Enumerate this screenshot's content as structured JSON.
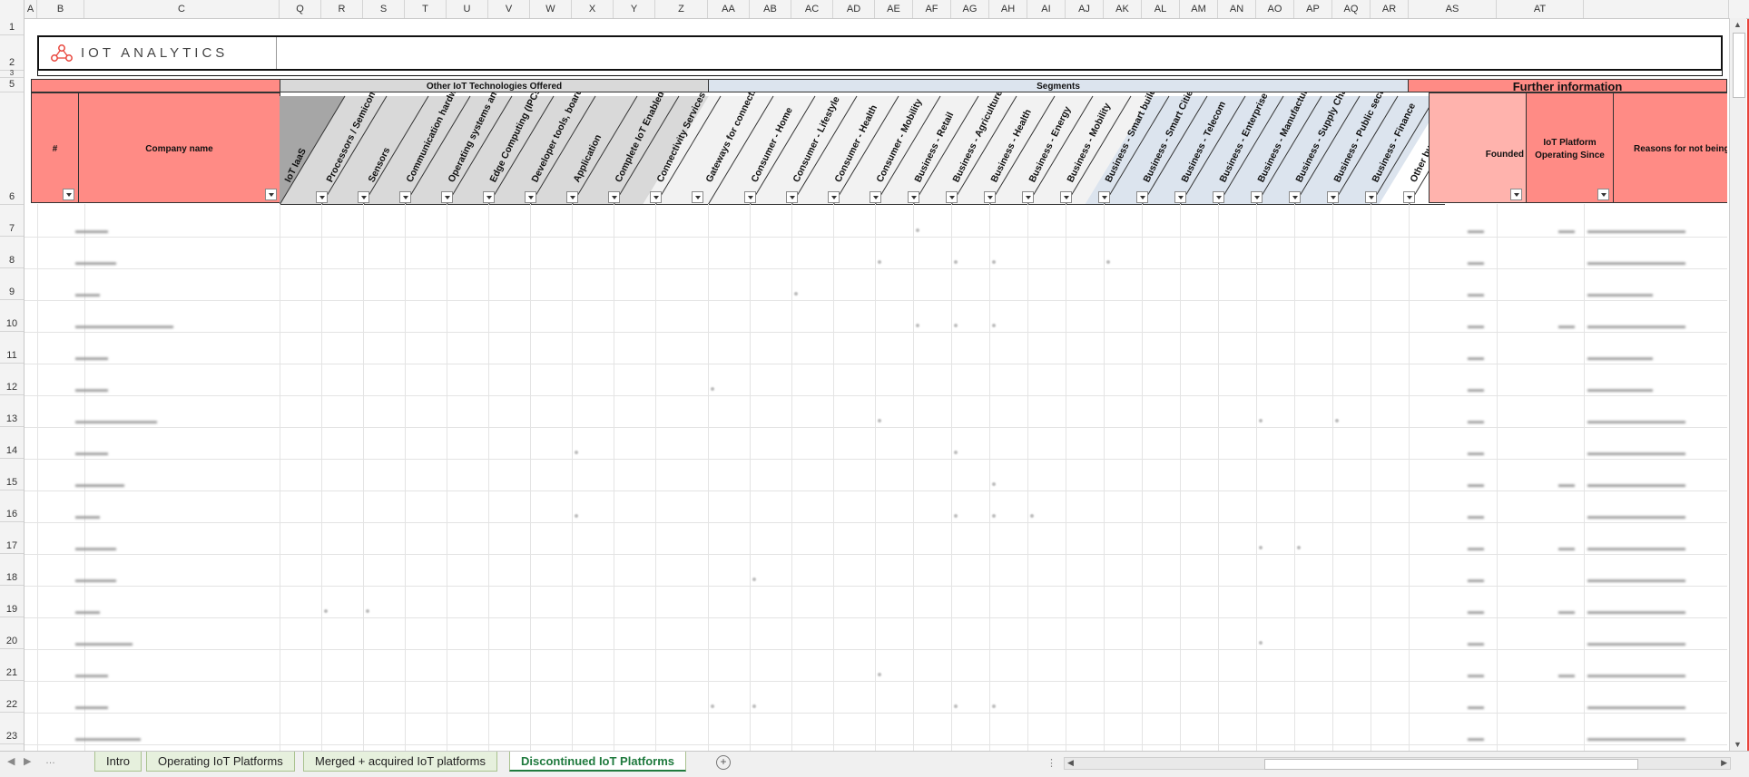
{
  "columns": [
    "A",
    "B",
    "C",
    "Q",
    "R",
    "S",
    "T",
    "U",
    "V",
    "W",
    "X",
    "Y",
    "Z",
    "AA",
    "AB",
    "AC",
    "AD",
    "AE",
    "AF",
    "AG",
    "AH",
    "AI",
    "AJ",
    "AK",
    "AL",
    "AM",
    "AN",
    "AO",
    "AP",
    "AQ",
    "AR",
    "AS",
    "AT"
  ],
  "rows": [
    "1",
    "2",
    "3",
    "5",
    "6",
    "7",
    "8",
    "9",
    "10",
    "11",
    "12",
    "13",
    "14",
    "15",
    "16",
    "17",
    "18",
    "19",
    "20",
    "21",
    "22",
    "23"
  ],
  "logo": {
    "text": "IOT ANALYTICS"
  },
  "groups": {
    "tech": "Other IoT Technologies Offered",
    "segments": "Segments",
    "further": "Further information"
  },
  "headers": {
    "num": "#",
    "company": "Company name",
    "founded": "Founded",
    "operating": "IoT Platform Operating Since",
    "reasons": "Reasons for not being co",
    "rotated": [
      "IoT IaaS",
      "Processors / Semiconductors",
      "Sensors",
      "Communication hardw. (Modules, SIMs, Gateways)",
      "Operating systems and virtualization tools",
      "Edge Computing (IPCs, PLCs etc.)",
      "Developer tools, board/kit",
      "Application",
      "Complete IoT Enabled Products / Assets",
      "Connectivity Services (e.g. MVNO)",
      "Gateways for connecting to platform",
      "Consumer - Home",
      "Consumer - Lifestyle",
      "Consumer - Health",
      "Consumer - Mobility",
      "Business - Retail",
      "Business - Agriculture",
      "Business - Health",
      "Business - Energy",
      "Business - Mobility",
      "Business - Smart buildings",
      "Business - Smart Cities",
      "Business - Telecom",
      "Business - Enterprise",
      "Business - Manufacturing / Industrial",
      "Business - Supply Chain",
      "Business - Public sector and services",
      "Business - Finance",
      "Other business"
    ]
  },
  "tabs": [
    {
      "label": "Intro"
    },
    {
      "label": "Operating IoT Platforms"
    },
    {
      "label": "Merged + acquired IoT platforms"
    },
    {
      "label": "Discontinued IoT Platforms",
      "active": true
    }
  ],
  "colors": {
    "red": "#ff8b85",
    "gray": "#d9d9d9",
    "blue": "#dce4ee",
    "green": "#1f7a3e"
  }
}
